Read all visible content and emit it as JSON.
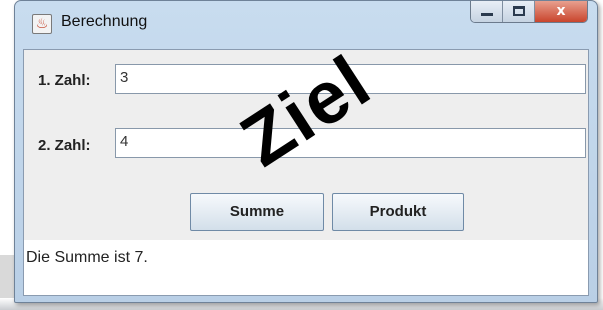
{
  "window": {
    "title": "Berechnung",
    "app_icon": "java-icon",
    "controls": {
      "minimize": "minimize-icon",
      "maximize": "maximize-icon",
      "close": "close-icon",
      "close_glyph": "x"
    }
  },
  "form": {
    "field1_label": "1. Zahl:",
    "field1_value": "3",
    "field2_label": "2. Zahl:",
    "field2_value": "4"
  },
  "buttons": {
    "sum_label": "Summe",
    "product_label": "Produkt"
  },
  "output": {
    "text": "Die Summe ist 7."
  },
  "overlay": {
    "text": "Ziel"
  },
  "colors": {
    "titlebar": "#c8dcef",
    "content_bg": "#eeeeee",
    "close_button": "#c9452d"
  }
}
